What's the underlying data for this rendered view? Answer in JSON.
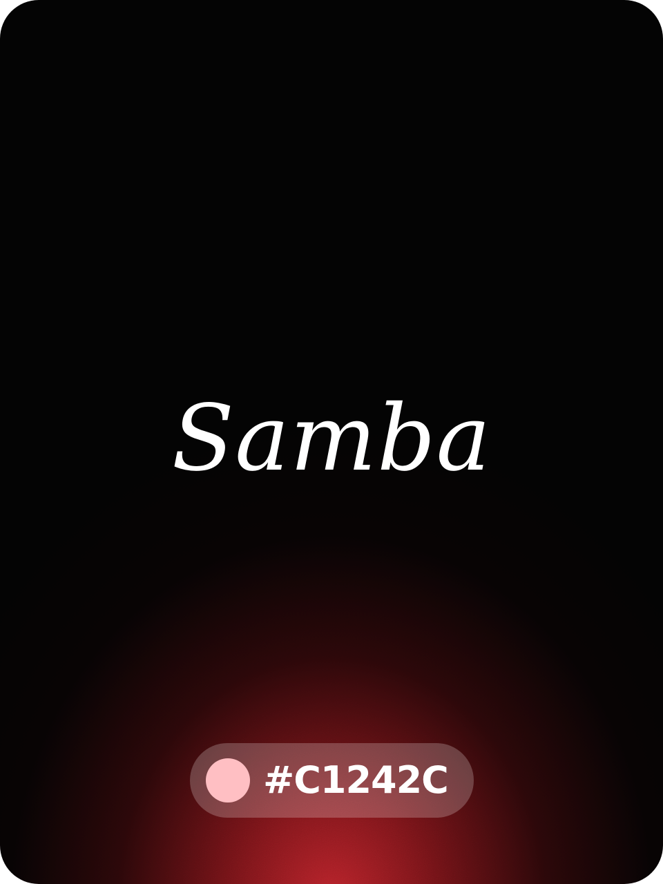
{
  "card": {
    "title": "Samba",
    "color_hex": "#C1242C",
    "swatch_color": "#ffbfc3",
    "background_color": "#030303"
  }
}
